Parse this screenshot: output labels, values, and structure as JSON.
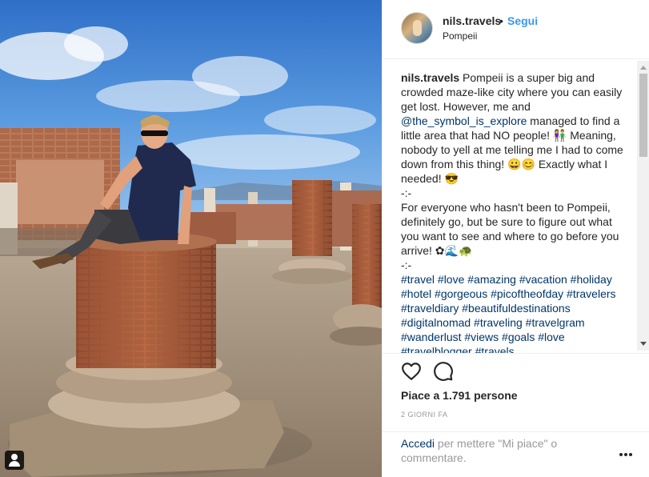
{
  "post": {
    "username": "nils.travels",
    "separator": "•",
    "follow_label": "Segui",
    "location": "Pompeii"
  },
  "caption": {
    "username": "nils.travels",
    "text_1": "Pompeii is a super big and crowded maze-like city where you can easily get lost. However, me and",
    "mention": "@the_symbol_is_explore",
    "text_2": "managed to find a little area that had NO people! 👫 Meaning, nobody to yell at me telling me I had to come down from this thing! 😀😊 Exactly what I needed! 😎",
    "divider_1": "-:-",
    "text_3": "For everyone who hasn't been to Pompeii, definitely go, but be sure to figure out what you want to see and where to go before you arrive! ✿🌊🐢",
    "divider_2": "-:-",
    "hashtags": "#travel #love #amazing #vacation #holiday #hotel #gorgeous #picoftheofday #travelers #traveldiary #beautifuldestinations #digitalnomad #traveling #travelgram #wanderlust #views #goals #love #travelblogger #travels"
  },
  "actions": {
    "likes_label": "Piace a 1.791 persone",
    "timestamp": "2 GIORNI FA"
  },
  "login": {
    "link_label": "Accedi",
    "rest_label": " per mettere \"Mi piace\" o commentare."
  },
  "icons": {
    "like": "heart-icon",
    "comment": "comment-icon",
    "more": "more-options-icon",
    "tag": "user-tag-icon"
  },
  "colors": {
    "link_blue": "#3897f0",
    "hashtag_blue": "#003569",
    "text": "#262626",
    "muted": "#999999"
  }
}
